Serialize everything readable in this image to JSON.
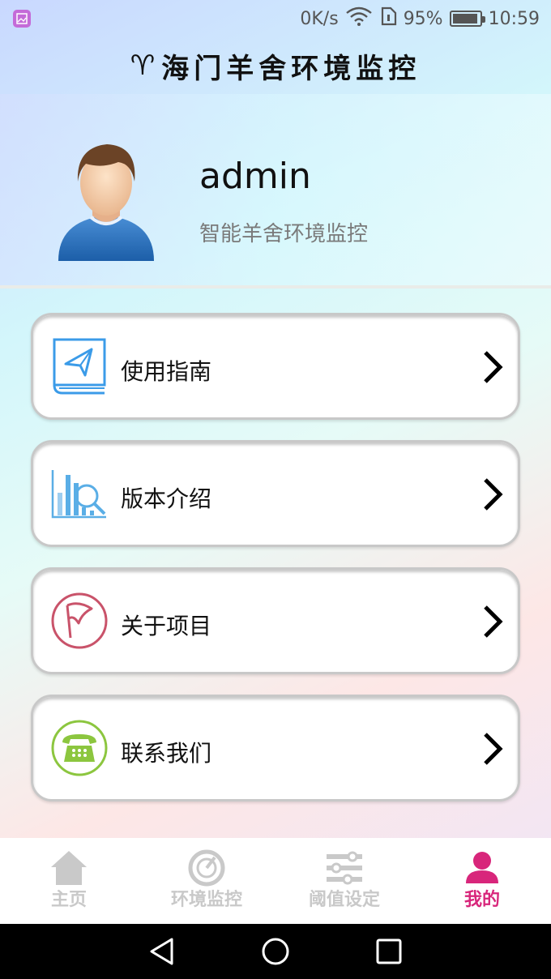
{
  "status_bar": {
    "speed": "0K/s",
    "battery": "95%",
    "time": "10:59"
  },
  "header": {
    "title": "海门羊舍环境监控",
    "logo_icon": "aries-icon"
  },
  "profile": {
    "username": "admin",
    "subtitle": "智能羊舍环境监控",
    "avatar_icon": "user-avatar-icon"
  },
  "menu": {
    "items": [
      {
        "label": "使用指南",
        "icon": "guide-book-icon"
      },
      {
        "label": "版本介绍",
        "icon": "version-chart-icon"
      },
      {
        "label": "关于项目",
        "icon": "flag-icon"
      },
      {
        "label": "联系我们",
        "icon": "telephone-icon"
      }
    ]
  },
  "bottom_nav": {
    "items": [
      {
        "label": "主页",
        "icon": "home-icon"
      },
      {
        "label": "环境监控",
        "icon": "gauge-icon"
      },
      {
        "label": "阈值设定",
        "icon": "sliders-icon"
      },
      {
        "label": "我的",
        "icon": "person-icon",
        "active": true
      }
    ]
  },
  "colors": {
    "accent": "#d8267b",
    "inactive": "#c9c9c9",
    "guide": "#3b9be8",
    "flag": "#c9536a",
    "phone": "#8cc63f"
  }
}
